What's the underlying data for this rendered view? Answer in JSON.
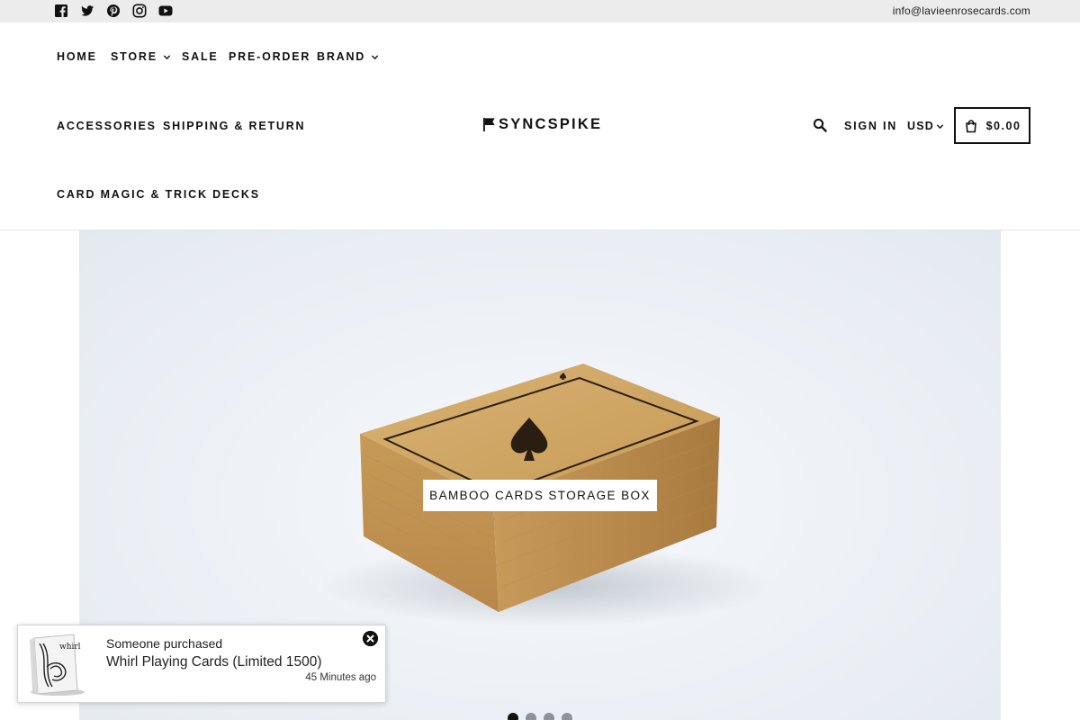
{
  "topbar": {
    "social_icons": [
      "facebook-icon",
      "twitter-icon",
      "pinterest-icon",
      "instagram-icon",
      "youtube-icon"
    ],
    "email": "info@lavieenrosecards.com"
  },
  "nav": {
    "home": "HOME",
    "store": "STORE",
    "sale": "SALE",
    "preorder": "PRE-ORDER",
    "brand": "BRAND",
    "accessories": "ACCESSORIES",
    "shipping": "SHIPPING & RETURN",
    "card_magic": "CARD MAGIC & TRICK DECKS"
  },
  "logo": {
    "text": "SYNCSPIKE",
    "icon": "flag-icon"
  },
  "header_actions": {
    "search_icon": "search-icon",
    "sign_in": "SIGN IN",
    "currency": "USD",
    "cart_icon": "cart-icon",
    "cart_total": "$0.00"
  },
  "hero": {
    "caption": "BAMBOO CARDS STORAGE BOX",
    "slide_count": 4,
    "active_slide": 1
  },
  "toast": {
    "line1": "Someone purchased",
    "product": "Whirl Playing Cards (Limited 1500)",
    "time": "45 Minutes ago",
    "box_text": "whirl"
  },
  "colors": {
    "topbar_bg": "#ececec",
    "text": "#111111",
    "dot_active": "#111111",
    "dot_inactive": "#8e939a"
  }
}
